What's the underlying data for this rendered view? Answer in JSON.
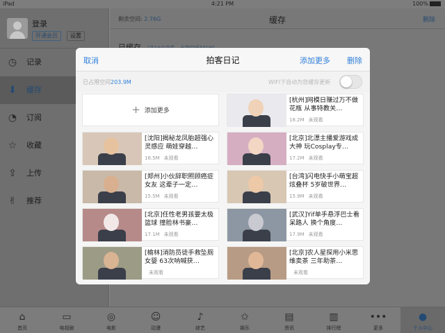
{
  "status": {
    "left": "iPad",
    "time": "4:21 PM",
    "battery": "100%"
  },
  "sidebar": {
    "login": "登录",
    "vip": "开通会员",
    "settings": "设置",
    "items": [
      {
        "label": "记录",
        "icon": "history-icon"
      },
      {
        "label": "缓存",
        "icon": "download-icon"
      },
      {
        "label": "订阅",
        "icon": "rss-icon"
      },
      {
        "label": "收藏",
        "icon": "star-icon"
      },
      {
        "label": "上传",
        "icon": "upload-icon"
      },
      {
        "label": "推荐",
        "icon": "thumbs-up-icon"
      }
    ]
  },
  "main": {
    "space_label": "剩余空间:",
    "space_value": "2.76G",
    "title": "缓存",
    "delete": "删除",
    "cached": "已缓存",
    "cached_sub": "(共14个文件，占用空间331M)"
  },
  "modal": {
    "cancel": "取消",
    "title": "拍客日记",
    "add_more": "添加更多",
    "delete": "删除",
    "used_label": "已占用空间",
    "used_value": "203.9M",
    "wifi_label": "WIFI下自动为您缓存更新",
    "wifi_on": false,
    "add_card_label": "添加更多",
    "unwatched": "未观看",
    "videos": [
      {
        "title": "[杭州]网模日赚过万不做花瓶  从事特教关…",
        "size": "18.2M",
        "thumb": "#e9e9ee"
      },
      {
        "title": "[沈阳]揭秘龙凤胎超强心灵感应 萌娃穿越…",
        "size": "16.5M",
        "thumb": "#d8c7b8"
      },
      {
        "title": "[北京]北漂主播爱游戏成大神 玩Cosplay专…",
        "size": "17.2M",
        "thumb": "#d5aec2"
      },
      {
        "title": "[郑州]小伙辞职照顾癌症女友 这辈子一定…",
        "size": "15.5M",
        "thumb": "#c9b9a8"
      },
      {
        "title": "[台湾]闪电快手小萌宝超炫叠杯 5岁破世界…",
        "size": "15.9M",
        "thumb": "#d7c7b3"
      },
      {
        "title": "[北京]任性老男孩要太极篮球 撞脸林书豪…",
        "size": "17.1M",
        "thumb": "#b78a8a"
      },
      {
        "title": "[武汉]Yif单手悬浮巴士看呆路人 换个角度…",
        "size": "17.9M",
        "thumb": "#8d97a3"
      },
      {
        "title": "[榆林]消防员徒手救坠厕女婴 63次呐喊获…",
        "size": "",
        "thumb": "#9c9b86"
      },
      {
        "title": "[北京]农人星探用小米思维卖茶 三年助茶…",
        "size": "",
        "thumb": "#b89b84"
      }
    ]
  },
  "tabbar": [
    {
      "label": "首页",
      "icon": "home-icon"
    },
    {
      "label": "电视剧",
      "icon": "tv-icon"
    },
    {
      "label": "电影",
      "icon": "film-icon"
    },
    {
      "label": "动漫",
      "icon": "anime-icon"
    },
    {
      "label": "综艺",
      "icon": "mic-icon"
    },
    {
      "label": "娱乐",
      "icon": "star-icon"
    },
    {
      "label": "资讯",
      "icon": "news-icon"
    },
    {
      "label": "排行榜",
      "icon": "ranking-icon"
    },
    {
      "label": "更多",
      "icon": "more-icon"
    },
    {
      "label": "个人中心",
      "icon": "user-icon"
    }
  ]
}
